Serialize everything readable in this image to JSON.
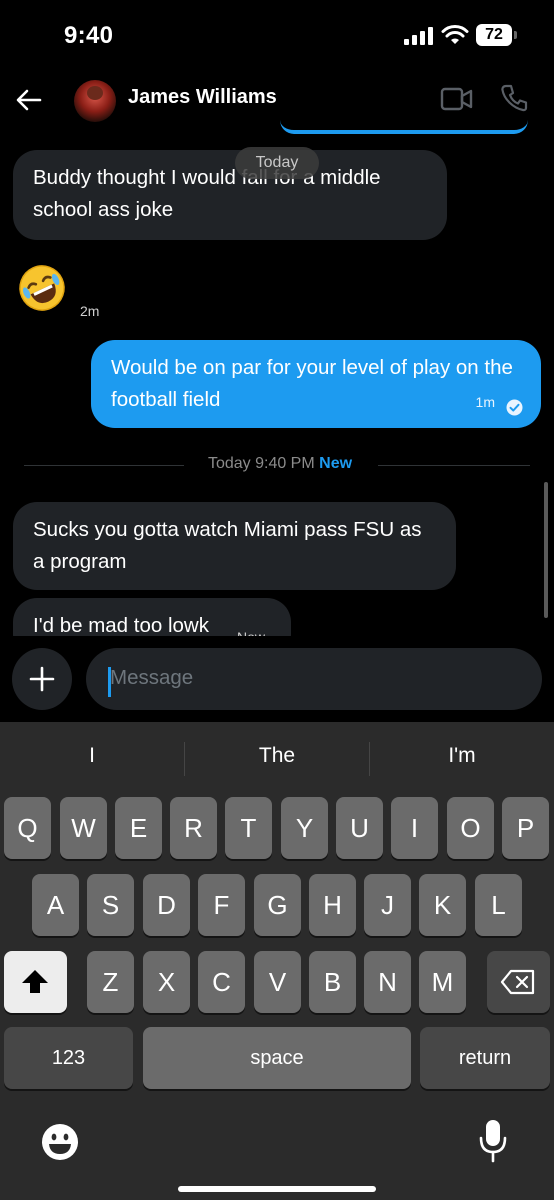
{
  "status_bar": {
    "time": "9:40",
    "battery": "72"
  },
  "header": {
    "contact_name": "James Williams"
  },
  "date_pill": "Today",
  "messages": [
    {
      "direction": "in",
      "text": "Buddy thought I would fall for a middle school ass joke"
    },
    {
      "direction": "in",
      "emoji": "rolling-on-floor-laughing",
      "time": "2m"
    },
    {
      "direction": "out",
      "text": "Would be on par for your level of play on the football field",
      "time": "1m"
    },
    {
      "direction": "in",
      "text": "Sucks you gotta watch Miami pass FSU as a program"
    },
    {
      "direction": "in",
      "text": "I'd be mad too lowk",
      "time": "Now"
    }
  ],
  "divider": {
    "text": "Today 9:40 PM",
    "new_label": "New"
  },
  "composer": {
    "placeholder": "Message"
  },
  "keyboard": {
    "suggestions": [
      "I",
      "The",
      "I'm"
    ],
    "row1": [
      "Q",
      "W",
      "E",
      "R",
      "T",
      "Y",
      "U",
      "I",
      "O",
      "P"
    ],
    "row2": [
      "A",
      "S",
      "D",
      "F",
      "G",
      "H",
      "J",
      "K",
      "L"
    ],
    "row3": [
      "Z",
      "X",
      "C",
      "V",
      "B",
      "N",
      "M"
    ],
    "numbers_label": "123",
    "space_label": "space",
    "return_label": "return"
  },
  "colors": {
    "accent": "#1d9bf0",
    "incoming_bubble": "#202327",
    "keyboard_bg": "#2b2b2b"
  }
}
